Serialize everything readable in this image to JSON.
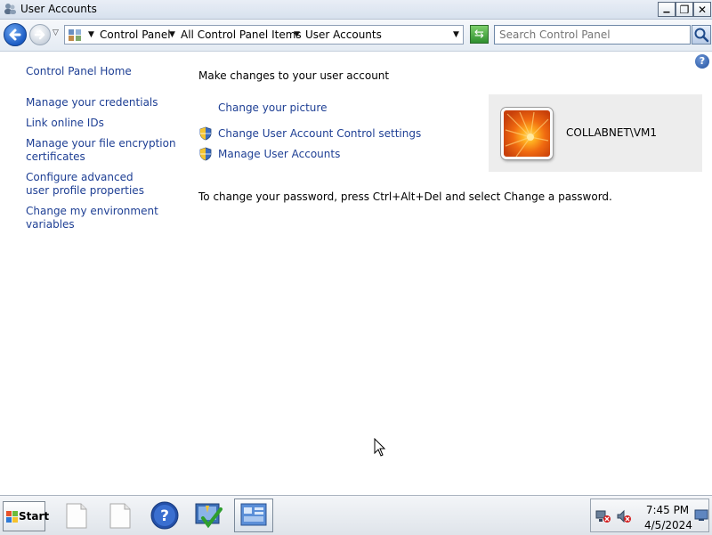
{
  "window": {
    "title": "User Accounts",
    "min_symbol": "▁",
    "max_symbol": "❐",
    "close_symbol": "✕"
  },
  "navigation": {
    "breadcrumbs": [
      "Control Panel",
      "All Control Panel Items",
      "User Accounts"
    ],
    "search_placeholder": "Search Control Panel"
  },
  "sidebar": {
    "home": "Control Panel Home",
    "links": [
      "Manage your credentials",
      "Link online IDs",
      "Manage your file encryption certificates",
      "Configure advanced user profile properties",
      "Change my environment variables"
    ]
  },
  "main": {
    "heading": "Make changes to your user account",
    "tasks": [
      "Change your picture",
      "Change User Account Control settings",
      "Manage User Accounts"
    ],
    "user_name": "COLLABNET\\VM1",
    "password_note": "To change your password, press Ctrl+Alt+Del and select Change a password."
  },
  "taskbar": {
    "start_label": "Start",
    "time": "7:45 PM",
    "date": "4/5/2024"
  },
  "icons": {
    "app": "user-accounts-icon",
    "back": "back-arrow-icon",
    "forward": "forward-arrow-icon",
    "search": "magnifier-icon",
    "help": "question-mark-icon",
    "shield": "uac-shield-icon",
    "taskbar": [
      "document-icon",
      "document-icon",
      "help-icon",
      "admin-checklist-icon",
      "control-panel-icon"
    ]
  },
  "colors": {
    "link": "#1e3f94",
    "user_panel_bg": "#ededed"
  }
}
